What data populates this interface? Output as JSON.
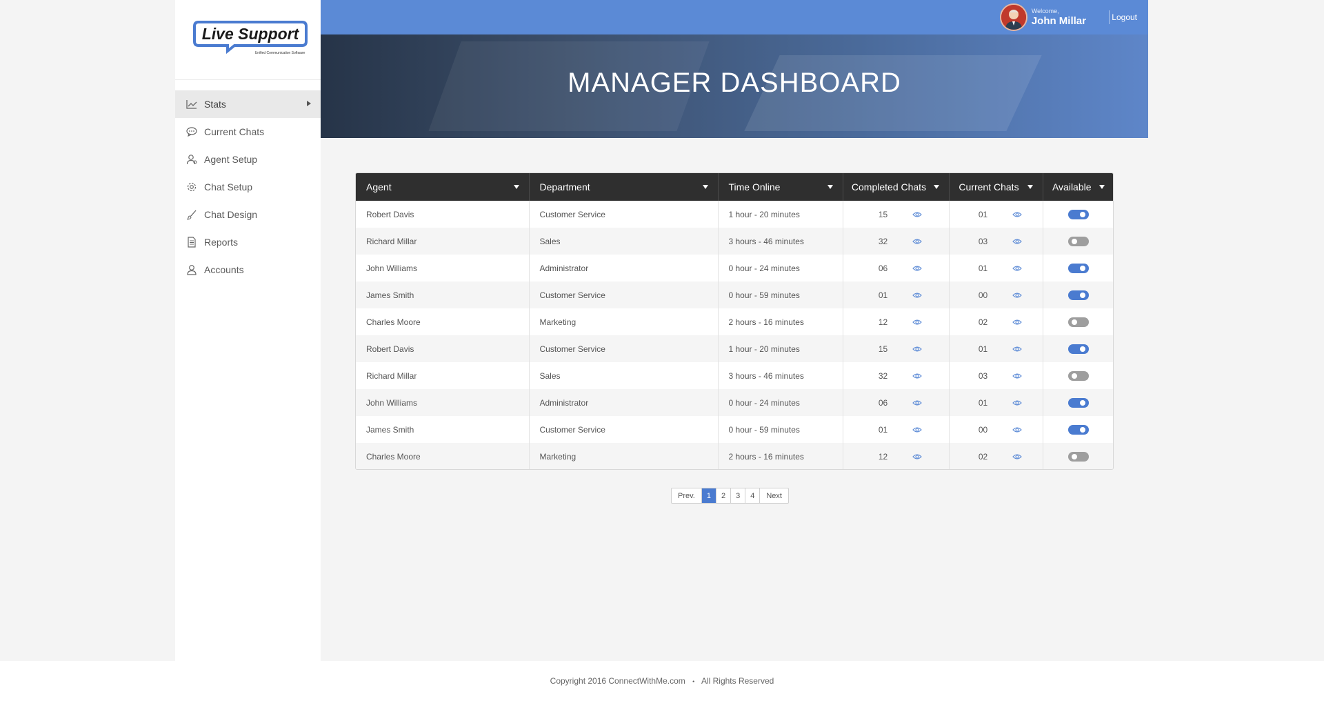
{
  "brand": {
    "name": "Live Support",
    "tagline": "Unified Communication Software"
  },
  "sidebar": {
    "items": [
      {
        "label": "Stats",
        "icon": "chart-icon",
        "active": true
      },
      {
        "label": "Current Chats",
        "icon": "chat-bubble-icon",
        "active": false
      },
      {
        "label": "Agent Setup",
        "icon": "agent-icon",
        "active": false
      },
      {
        "label": "Chat Setup",
        "icon": "gear-icon",
        "active": false
      },
      {
        "label": "Chat Design",
        "icon": "brush-icon",
        "active": false
      },
      {
        "label": "Reports",
        "icon": "document-icon",
        "active": false
      },
      {
        "label": "Accounts",
        "icon": "user-icon",
        "active": false
      }
    ]
  },
  "header": {
    "welcome": "Welcome,",
    "user_name": "John Millar",
    "logout": "Logout"
  },
  "hero": {
    "title": "MANAGER DASHBOARD"
  },
  "table": {
    "columns": [
      "Agent",
      "Department",
      "Time Online",
      "Completed Chats",
      "Current Chats",
      "Available"
    ],
    "rows": [
      {
        "agent": "Robert Davis",
        "department": "Customer Service",
        "time_online": "1 hour  -  20 minutes",
        "completed": "15",
        "current": "01",
        "available": true
      },
      {
        "agent": "Richard Millar",
        "department": "Sales",
        "time_online": "3 hours  -  46 minutes",
        "completed": "32",
        "current": "03",
        "available": false
      },
      {
        "agent": "John Williams",
        "department": "Administrator",
        "time_online": "0 hour  -  24 minutes",
        "completed": "06",
        "current": "01",
        "available": true
      },
      {
        "agent": "James Smith",
        "department": "Customer Service",
        "time_online": "0 hour  -  59 minutes",
        "completed": "01",
        "current": "00",
        "available": true
      },
      {
        "agent": "Charles Moore",
        "department": "Marketing",
        "time_online": "2 hours  -  16 minutes",
        "completed": "12",
        "current": "02",
        "available": false
      },
      {
        "agent": "Robert Davis",
        "department": "Customer Service",
        "time_online": "1 hour  -  20 minutes",
        "completed": "15",
        "current": "01",
        "available": true
      },
      {
        "agent": "Richard Millar",
        "department": "Sales",
        "time_online": "3 hours  -  46 minutes",
        "completed": "32",
        "current": "03",
        "available": false
      },
      {
        "agent": "John Williams",
        "department": "Administrator",
        "time_online": "0 hour  -  24 minutes",
        "completed": "06",
        "current": "01",
        "available": true
      },
      {
        "agent": "James Smith",
        "department": "Customer Service",
        "time_online": "0 hour  -  59 minutes",
        "completed": "01",
        "current": "00",
        "available": true
      },
      {
        "agent": "Charles Moore",
        "department": "Marketing",
        "time_online": "2 hours  -  16 minutes",
        "completed": "12",
        "current": "02",
        "available": false
      }
    ]
  },
  "pagination": {
    "prev": "Prev.",
    "pages": [
      "1",
      "2",
      "3",
      "4"
    ],
    "current": "1",
    "next": "Next"
  },
  "footer": {
    "copyright": "Copyright 2016 ConnectWithMe.com",
    "separator": "•",
    "rights": "All Rights Reserved"
  },
  "colors": {
    "accent": "#5b8ad6",
    "toggle_on": "#4a7bd0",
    "toggle_off": "#9e9e9e",
    "table_header": "#2f2f2f",
    "eye_icon": "#5b8ad6"
  }
}
